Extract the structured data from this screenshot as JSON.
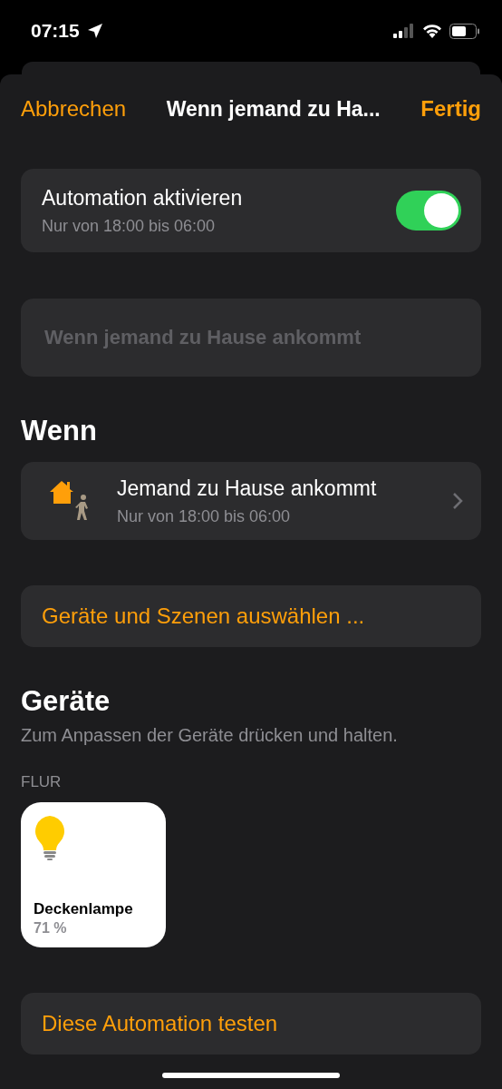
{
  "status_bar": {
    "time": "07:15"
  },
  "nav": {
    "cancel": "Abbrechen",
    "title": "Wenn jemand zu Ha...",
    "done": "Fertig"
  },
  "activation": {
    "label": "Automation aktivieren",
    "detail": "Nur von 18:00 bis 06:00",
    "on": true
  },
  "name_field": {
    "placeholder": "Wenn jemand zu Hause ankommt"
  },
  "trigger_section": {
    "heading": "Wenn",
    "title": "Jemand zu Hause ankommt",
    "detail": "Nur von 18:00 bis 06:00"
  },
  "select_button": "Geräte und Szenen auswählen ...",
  "devices_section": {
    "heading": "Geräte",
    "hint": "Zum Anpassen der Geräte drücken und halten.",
    "room": "FLUR",
    "devices": [
      {
        "name": "Deckenlampe",
        "state": "71 %",
        "on": true
      }
    ]
  },
  "test_button": "Diese Automation testen"
}
